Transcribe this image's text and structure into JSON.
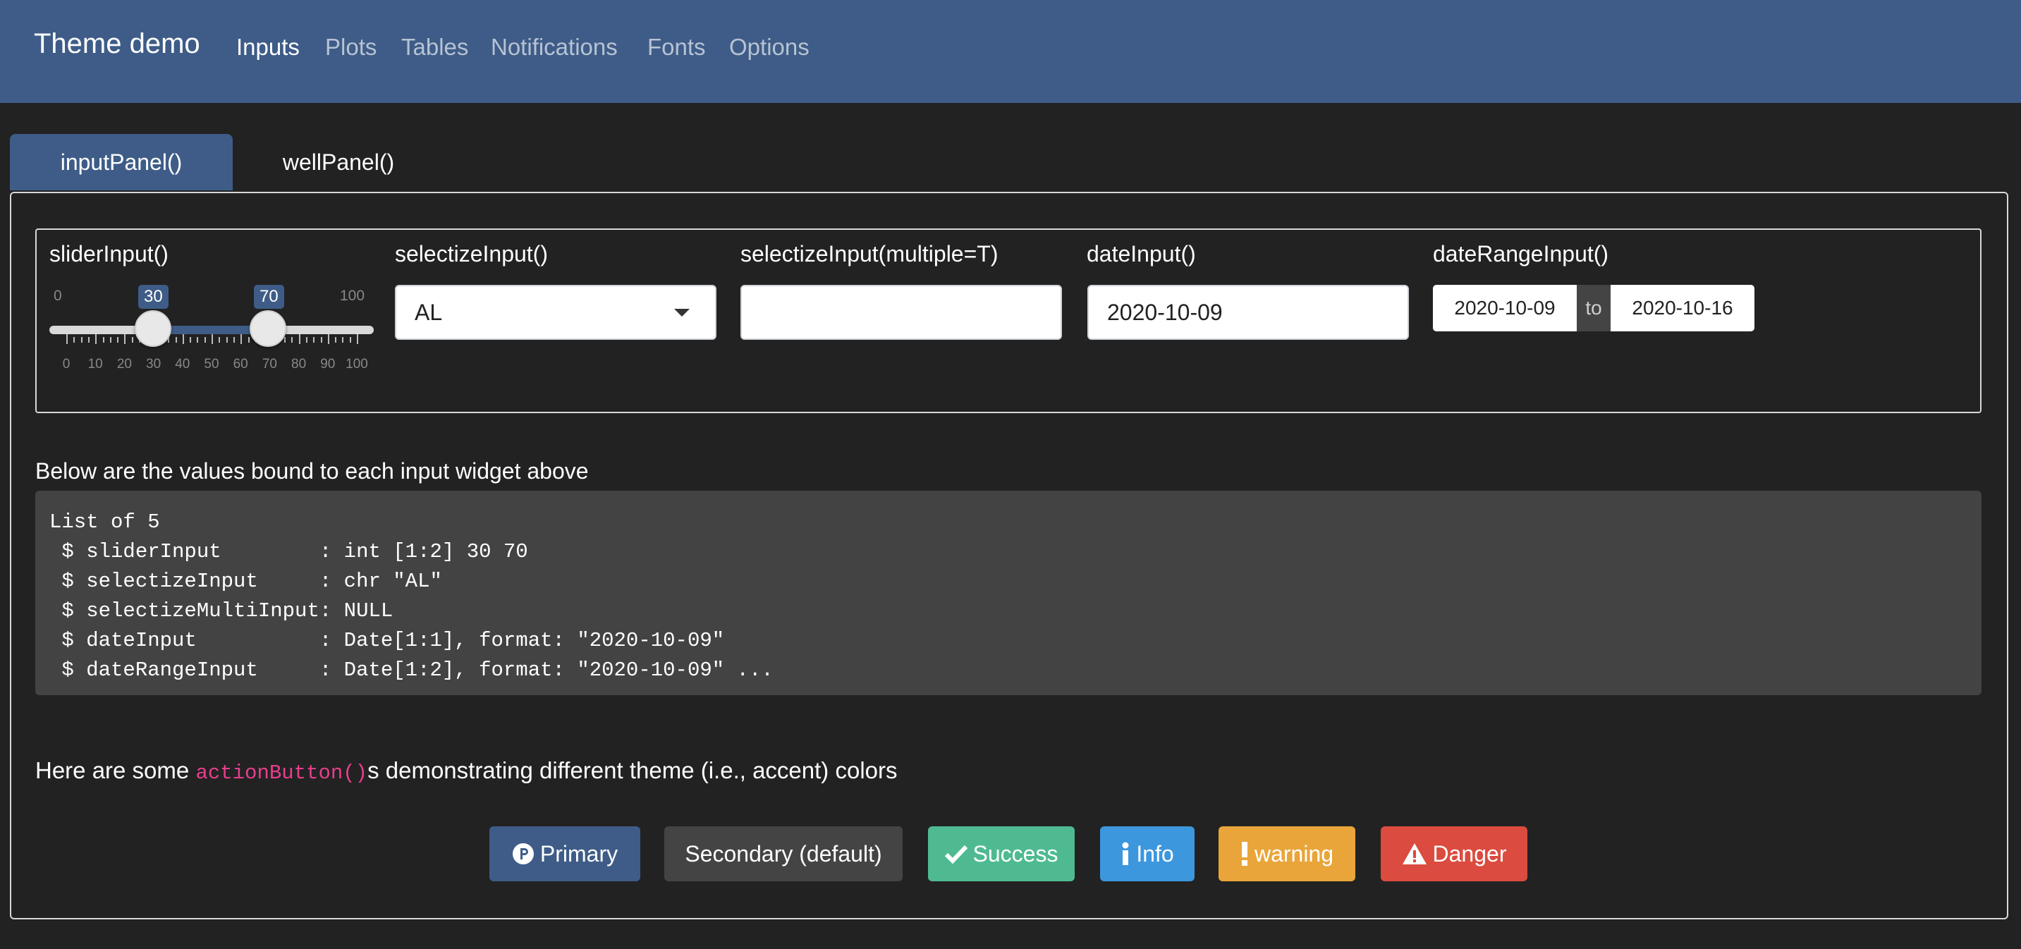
{
  "navbar": {
    "brand": "Theme demo",
    "items": [
      {
        "label": "Inputs",
        "active": true
      },
      {
        "label": "Plots",
        "active": false
      },
      {
        "label": "Tables",
        "active": false
      },
      {
        "label": "Notifications",
        "active": false
      },
      {
        "label": "Fonts",
        "active": false
      },
      {
        "label": "Options",
        "active": false
      }
    ]
  },
  "tabs": [
    {
      "label": "inputPanel()",
      "active": true
    },
    {
      "label": "wellPanel()",
      "active": false
    }
  ],
  "inputs": {
    "slider": {
      "label": "sliderInput()",
      "min": 0,
      "max": 100,
      "min_label": "0",
      "max_label": "100",
      "value_low": 30,
      "value_high": 70,
      "value_low_label": "30",
      "value_high_label": "70",
      "tick_labels": [
        "0",
        "10",
        "20",
        "30",
        "40",
        "50",
        "60",
        "70",
        "80",
        "90",
        "100"
      ]
    },
    "selectize": {
      "label": "selectizeInput()",
      "value": "AL"
    },
    "selectize_multi": {
      "label": "selectizeInput(multiple=T)",
      "value": ""
    },
    "date": {
      "label": "dateInput()",
      "value": "2020-10-09"
    },
    "date_range": {
      "label": "dateRangeInput()",
      "start": "2020-10-09",
      "separator": "to",
      "end": "2020-10-16"
    }
  },
  "output": {
    "caption": "Below are the values bound to each input widget above",
    "lines": [
      "List of 5",
      " $ sliderInput        : int [1:2] 30 70",
      " $ selectizeInput     : chr \"AL\"",
      " $ selectizeMultiInput: NULL",
      " $ dateInput          : Date[1:1], format: \"2020-10-09\"",
      " $ dateRangeInput     : Date[1:2], format: \"2020-10-09\" ..."
    ]
  },
  "buttons_section": {
    "caption_before": "Here are some ",
    "caption_code": "actionButton()",
    "caption_after": "s demonstrating different theme (i.e., accent) colors",
    "buttons": [
      {
        "label": "Primary",
        "icon": "product-hunt-icon",
        "color": "#3e5c87"
      },
      {
        "label": "Secondary (default)",
        "icon": "",
        "color": "#444444"
      },
      {
        "label": "Success",
        "icon": "check-icon",
        "color": "#4fba91"
      },
      {
        "label": "Info",
        "icon": "info-icon",
        "color": "#3c97dd"
      },
      {
        "label": "warning",
        "icon": "exclamation-icon",
        "color": "#e9a53a"
      },
      {
        "label": "Danger",
        "icon": "warning-triangle-icon",
        "color": "#db4b3f"
      }
    ]
  },
  "colors": {
    "navbar_bg": "#3e5c87",
    "page_bg": "#222222",
    "code_accent": "#e83e8c"
  }
}
